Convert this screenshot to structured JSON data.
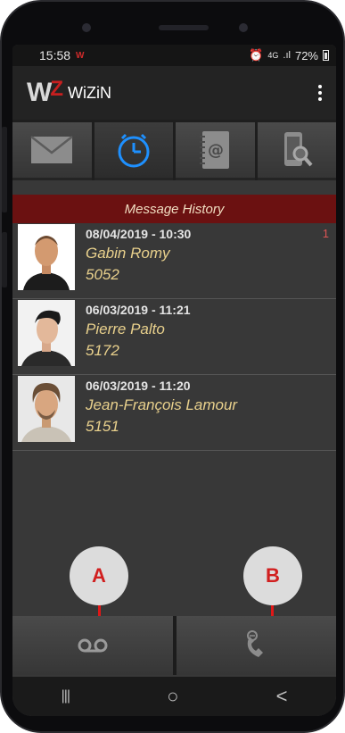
{
  "status": {
    "time": "15:58",
    "network": "4G",
    "battery": "72%"
  },
  "app": {
    "name": "WiZiN"
  },
  "tabs": [
    {
      "icon": "envelope-icon"
    },
    {
      "icon": "clock-icon",
      "active": true
    },
    {
      "icon": "address-book-icon"
    },
    {
      "icon": "phone-search-icon"
    }
  ],
  "section_title": "Message History",
  "messages": [
    {
      "date": "08/04/2019 - 10:30",
      "name": "Gabin Romy",
      "ext": "5052",
      "badge": "1"
    },
    {
      "date": "06/03/2019 - 11:21",
      "name": "Pierre Palto",
      "ext": "5172",
      "badge": ""
    },
    {
      "date": "06/03/2019 - 11:20",
      "name": "Jean-François Lamour",
      "ext": "5151",
      "badge": ""
    }
  ],
  "callouts": {
    "a": "A",
    "b": "B"
  },
  "bottom_actions": [
    {
      "icon": "voicemail-icon"
    },
    {
      "icon": "call-message-icon"
    }
  ],
  "nav": {
    "recent": "|||",
    "home": "○",
    "back": "<"
  },
  "colors": {
    "header_red": "#6b1111",
    "accent_blue": "#1e90ff",
    "name_gold": "#e8d08c",
    "callout_red": "#d11f1f"
  }
}
